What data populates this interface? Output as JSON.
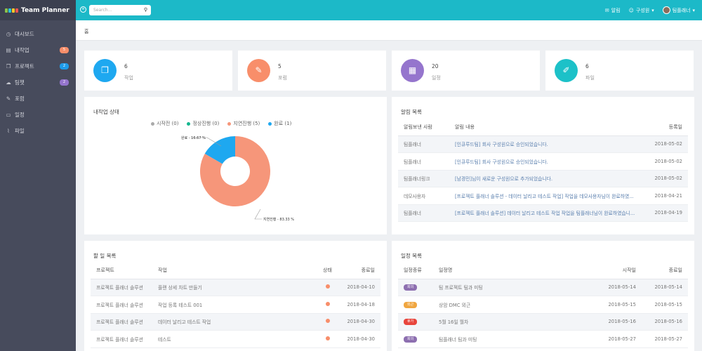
{
  "brand": {
    "name": "Team Planner",
    "logo_colors": [
      "#8bc34a",
      "#26c6da",
      "#ffca28",
      "#ef5350"
    ]
  },
  "sidebar": {
    "items": [
      {
        "label": "대시보드",
        "icon": "dashboard-icon",
        "glyph": "◷",
        "badge": null
      },
      {
        "label": "내작업",
        "icon": "document-icon",
        "glyph": "▤",
        "badge": "5",
        "badge_color": "#f88e6a"
      },
      {
        "label": "프로젝트",
        "icon": "copy-icon",
        "glyph": "❐",
        "badge": "2",
        "badge_color": "#1e9be9"
      },
      {
        "label": "팀챗",
        "icon": "chat-icon",
        "glyph": "☁",
        "badge": "2",
        "badge_color": "#9575cd"
      },
      {
        "label": "포럼",
        "icon": "edit-icon",
        "glyph": "✎",
        "badge": null
      },
      {
        "label": "일정",
        "icon": "calendar-icon",
        "glyph": "▭",
        "badge": null
      },
      {
        "label": "파일",
        "icon": "paperclip-icon",
        "glyph": "⌇",
        "badge": null
      }
    ]
  },
  "topbar": {
    "search_placeholder": "Search...",
    "alerts_label": "알림",
    "members_label": "구성원",
    "user_label": "팀플래너"
  },
  "breadcrumb": "홈",
  "stats": [
    {
      "value": "6",
      "label": "작업",
      "color": "#1ea8f0",
      "icon": "tasks-icon",
      "glyph": "❐"
    },
    {
      "value": "5",
      "label": "포럼",
      "color": "#f88e6a",
      "icon": "edit-icon",
      "glyph": "✎"
    },
    {
      "value": "20",
      "label": "일정",
      "color": "#9575cd",
      "icon": "calendar-icon",
      "glyph": "▦"
    },
    {
      "value": "6",
      "label": "파일",
      "color": "#1cc1c8",
      "icon": "paperclip-icon",
      "glyph": "✐"
    }
  ],
  "my_task_status": {
    "title": "내작업 상태",
    "chart_data": {
      "type": "pie",
      "labels": [
        "시작전 (0)",
        "정상진행 (0)",
        "지연진행 (5)",
        "완료 (1)"
      ],
      "values": [
        0,
        0,
        5,
        1
      ],
      "colors": [
        "#aaaaaa",
        "#15b68f",
        "#f6967a",
        "#1ea8f0"
      ],
      "slice_labels": [
        "완료 - 16.67 %",
        "지연진행 - 83.33 %"
      ]
    }
  },
  "notifications": {
    "title": "알림 목록",
    "columns": [
      "알림보낸 사람",
      "알림 내용",
      "등록일"
    ],
    "rows": [
      {
        "sender": "팀플래너",
        "content": "[인큐루드팀] 회사 구성원으로 승인되었습니다.",
        "date": "2018-05-02"
      },
      {
        "sender": "팀플래너",
        "content": "[인큐루드팀] 회사 구성원으로 승인되었습니다.",
        "date": "2018-05-02"
      },
      {
        "sender": "팀플래너링크",
        "content": "[남경민]님이 새로운 구성원으로 추가되었습니다.",
        "date": "2018-05-02"
      },
      {
        "sender": "데모사용자",
        "content": "[프로젝트 플래너 솔루션 - 데이터 날리고 테스트 작업] 작업을 데모사용자님이 완료하였...",
        "date": "2018-04-21"
      },
      {
        "sender": "팀플래너",
        "content": "[프로젝트 플래너 솔루션] 데이터 날리고 테스트 작업 작업을 팀플래너님이 완료하였습니...",
        "date": "2018-04-19"
      }
    ]
  },
  "todo": {
    "title": "할 일 목록",
    "columns": [
      "프로젝트",
      "작업",
      "상태",
      "종료일"
    ],
    "rows": [
      {
        "project": "프로젝트 플래너 솔루션",
        "task": "플랜 상세 차트 만들기",
        "date": "2018-04-10"
      },
      {
        "project": "프로젝트 플래너 솔루션",
        "task": "작업 등록 테스트 001",
        "date": "2018-04-18"
      },
      {
        "project": "프로젝트 플래너 솔루션",
        "task": "데이터 날리고 테스트 작업",
        "date": "2018-04-30"
      },
      {
        "project": "프로젝트 플래너 솔루션",
        "task": "테스트",
        "date": "2018-04-30"
      }
    ]
  },
  "schedule": {
    "title": "일정 목록",
    "columns": [
      "일정종류",
      "일정명",
      "시작일",
      "종료일"
    ],
    "rows": [
      {
        "type": "회의",
        "type_color": "#8d6fb0",
        "name": "팀 프로젝트 팀과 미팅",
        "start": "2018-05-14",
        "end": "2018-05-14"
      },
      {
        "type": "외근",
        "type_color": "#f0a640",
        "name": "상암 DMC 외근",
        "start": "2018-05-15",
        "end": "2018-05-15"
      },
      {
        "type": "휴가",
        "type_color": "#e8453c",
        "name": "5월 16일 월차",
        "start": "2018-05-16",
        "end": "2018-05-16"
      },
      {
        "type": "회의",
        "type_color": "#8d6fb0",
        "name": "팀플래너 팀과 미팅",
        "start": "2018-05-27",
        "end": "2018-05-27"
      }
    ]
  }
}
